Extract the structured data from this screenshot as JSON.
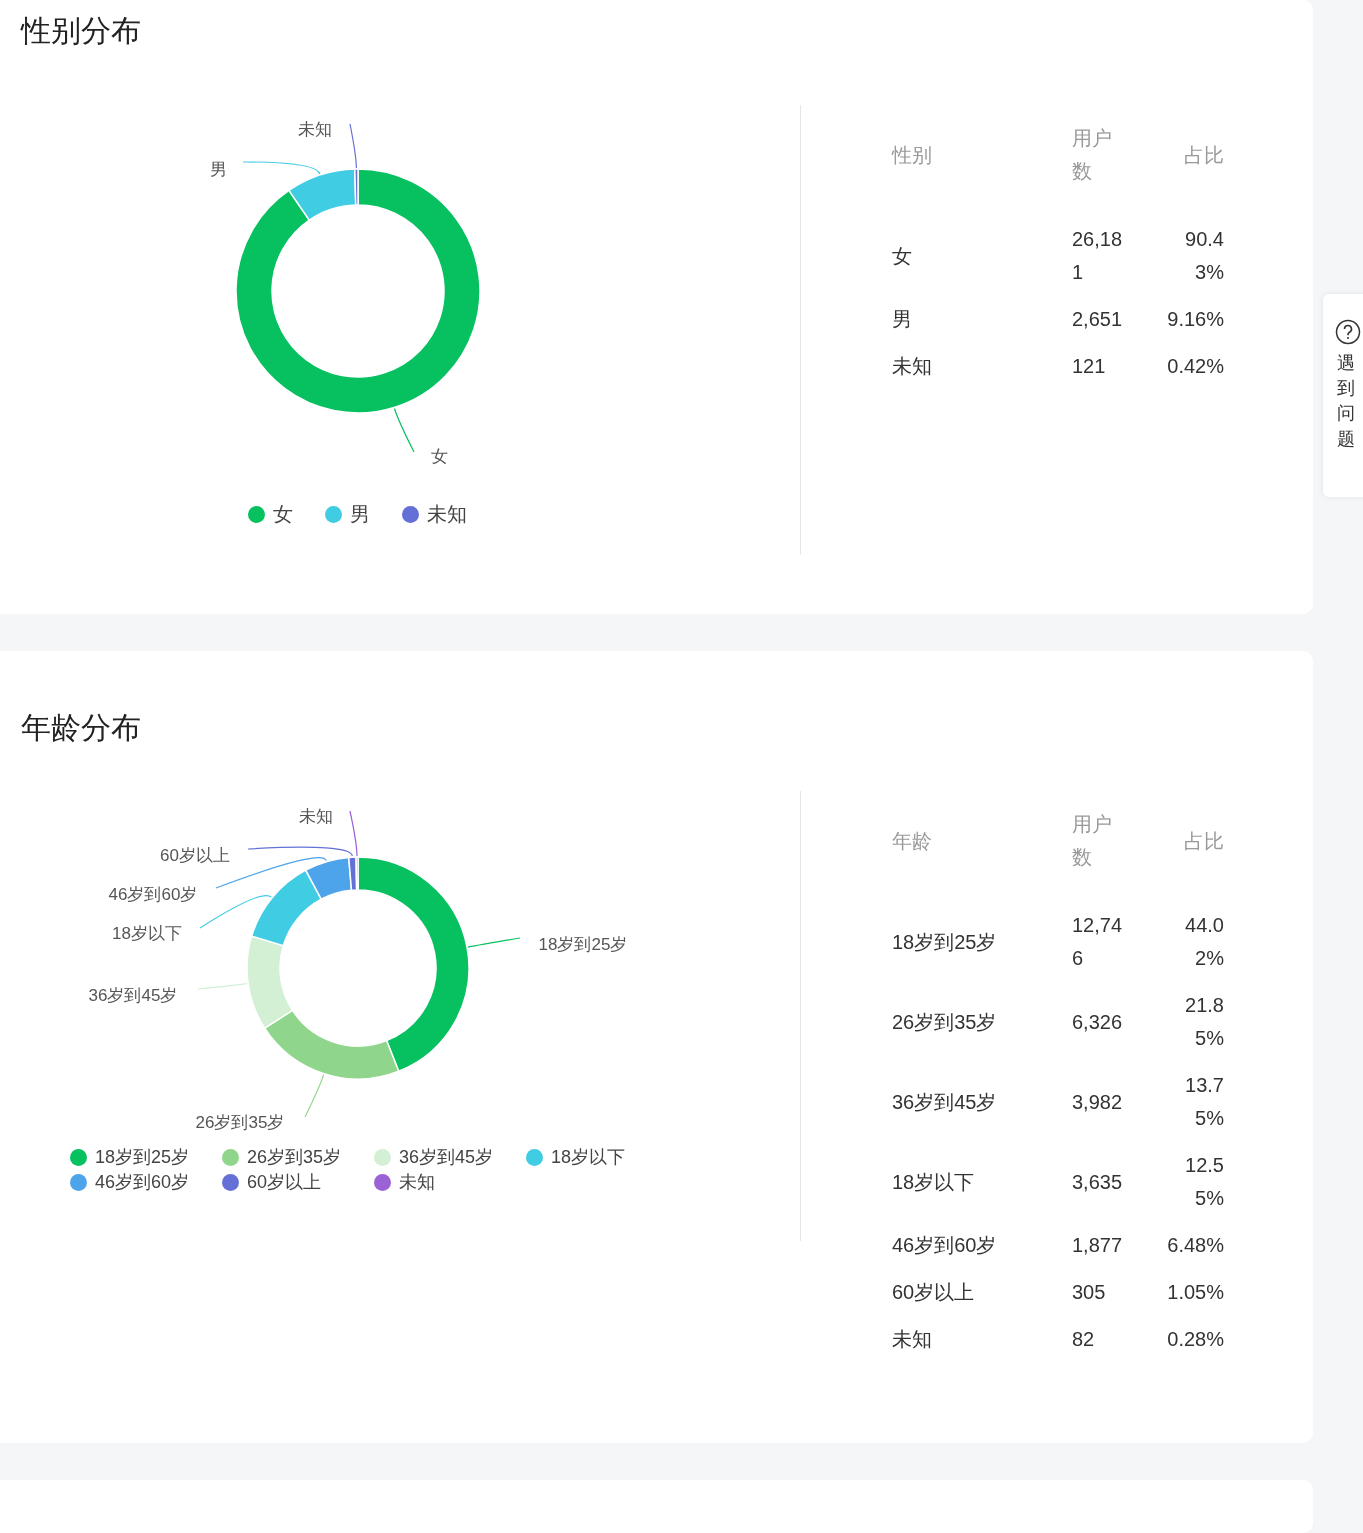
{
  "sections": [
    {
      "title": "性别分布",
      "chart_data": {
        "type": "donut",
        "categories": [
          "女",
          "男",
          "未知"
        ],
        "values": [
          90.43,
          9.16,
          0.42
        ]
      },
      "legend": [
        {
          "label": "女",
          "color": "#07c160"
        },
        {
          "label": "男",
          "color": "#40cce3"
        },
        {
          "label": "未知",
          "color": "#6470d6"
        }
      ],
      "table": {
        "columns": [
          "性别",
          "用户数",
          "占比"
        ],
        "rows": [
          [
            "女",
            "26,181",
            "90.43%"
          ],
          [
            "男",
            "2,651",
            "9.16%"
          ],
          [
            "未知",
            "121",
            "0.42%"
          ]
        ]
      }
    },
    {
      "title": "年龄分布",
      "chart_data": {
        "type": "donut",
        "categories": [
          "18岁到25岁",
          "26岁到35岁",
          "36岁到45岁",
          "18岁以下",
          "46岁到60岁",
          "60岁以上",
          "未知"
        ],
        "values": [
          44.02,
          21.85,
          13.75,
          12.55,
          6.48,
          1.05,
          0.28
        ]
      },
      "legend": [
        {
          "label": "18岁到25岁",
          "color": "#07c160"
        },
        {
          "label": "26岁到35岁",
          "color": "#8fd68c"
        },
        {
          "label": "36岁到45岁",
          "color": "#d3f0d4"
        },
        {
          "label": "18岁以下",
          "color": "#40cce3"
        },
        {
          "label": "46岁到60岁",
          "color": "#4ea4ea"
        },
        {
          "label": "60岁以上",
          "color": "#6470d6"
        },
        {
          "label": "未知",
          "color": "#9b62d6"
        }
      ],
      "table": {
        "columns": [
          "年龄",
          "用户数",
          "占比"
        ],
        "rows": [
          [
            "18岁到25岁",
            "12,746",
            "44.02%"
          ],
          [
            "26岁到35岁",
            "6,326",
            "21.85%"
          ],
          [
            "36岁到45岁",
            "3,982",
            "13.75%"
          ],
          [
            "18岁以下",
            "3,635",
            "12.55%"
          ],
          [
            "46岁到60岁",
            "1,877",
            "6.48%"
          ],
          [
            "60岁以上",
            "305",
            "1.05%"
          ],
          [
            "未知",
            "82",
            "0.28%"
          ]
        ]
      }
    }
  ],
  "help_tab": {
    "label": "遇到问题"
  }
}
